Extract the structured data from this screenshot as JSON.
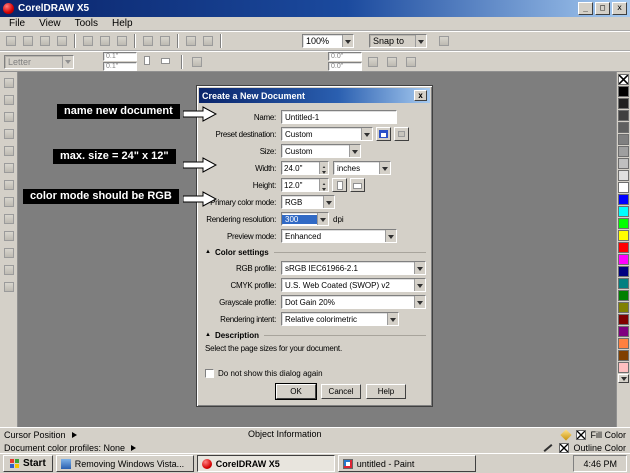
{
  "icons": {
    "close": "x",
    "minimize": "_",
    "maximize": "□",
    "collapse": "▲"
  },
  "titlebar": {
    "title": "CorelDRAW X5"
  },
  "menu": {
    "items": [
      "File",
      "View",
      "Tools",
      "Help"
    ]
  },
  "toolbar": {
    "zoom": "100%",
    "snap": "Snap to"
  },
  "propbar": {
    "paper": "Letter",
    "field_top": "0.1\"",
    "field_bottom": "0.1\"",
    "field2_top": "0.0\"",
    "field2_bottom": "0.0\""
  },
  "dialog": {
    "title": "Create a New Document",
    "name_label": "Name:",
    "name_value": "Untitled-1",
    "preset_label": "Preset destination:",
    "preset_value": "Custom",
    "size_label": "Size:",
    "size_value": "Custom",
    "width_label": "Width:",
    "width_value": "24.0\"",
    "units_value": "inches",
    "height_label": "Height:",
    "height_value": "12.0\"",
    "colormode_label": "Primary color mode:",
    "colormode_value": "RGB",
    "resolution_label": "Rendering resolution:",
    "resolution_value": "300",
    "resolution_units": "dpi",
    "preview_label": "Preview mode:",
    "preview_value": "Enhanced",
    "color_settings_header": "Color settings",
    "rgb_label": "RGB profile:",
    "rgb_value": "sRGB IEC61966-2.1",
    "cmyk_label": "CMYK profile:",
    "cmyk_value": "U.S. Web Coated (SWOP) v2",
    "gray_label": "Grayscale profile:",
    "gray_value": "Dot Gain 20%",
    "intent_label": "Rendering intent:",
    "intent_value": "Relative colorimetric",
    "description_header": "Description",
    "description_text": "Select the page sizes for your document.",
    "checkbox_label": "Do not show this dialog again",
    "ok": "OK",
    "cancel": "Cancel",
    "help": "Help"
  },
  "annotations": {
    "name": "name new document",
    "size": "max. size = 24\" x 12\"",
    "color": "color mode should be RGB"
  },
  "statusbar": {
    "cursor": "Cursor Position",
    "object_info": "Object Information",
    "fill": "Fill Color",
    "outline": "Outline Color",
    "profiles": "Document color profiles: None"
  },
  "taskbar": {
    "start": "Start",
    "task1": "Removing Windows Vista...",
    "task2": "CorelDRAW X5",
    "task3": "untitled - Paint",
    "time": "4:46 PM"
  },
  "colors": {
    "selection": "#316ac5"
  },
  "palette": {
    "colors": [
      "#000000",
      "#202020",
      "#404040",
      "#606060",
      "#808080",
      "#9f9f9f",
      "#bfbfbf",
      "#dfdfdf",
      "#ffffff",
      "#0000ff",
      "#00ffff",
      "#00ff00",
      "#ffff00",
      "#ff0000",
      "#ff00ff",
      "#000080",
      "#008080",
      "#008000",
      "#808000",
      "#800000",
      "#800080",
      "#ff8040",
      "#804000",
      "#ffc0c0"
    ]
  }
}
